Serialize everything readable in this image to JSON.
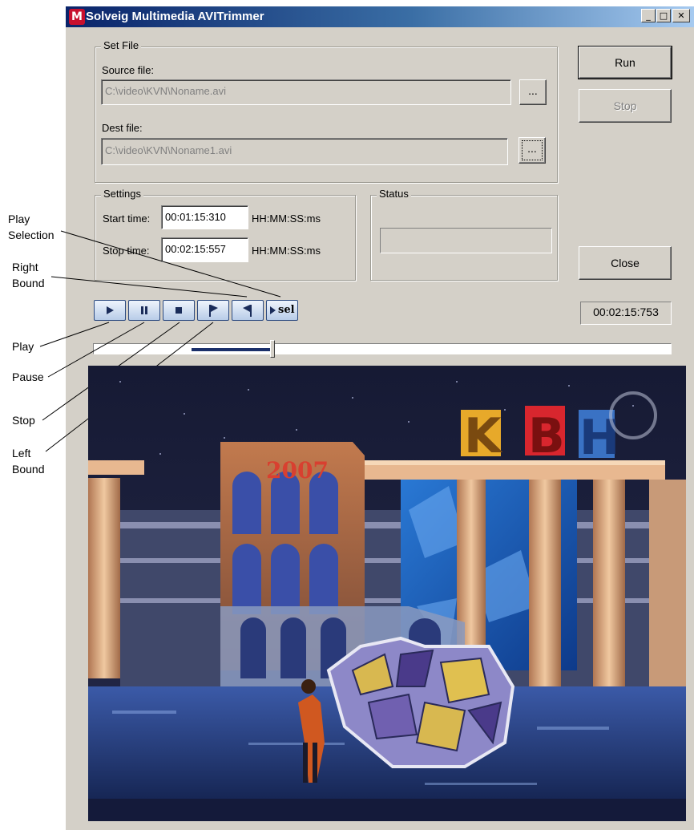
{
  "window": {
    "title": "Solveig Multimedia AVITrimmer",
    "icon_name": "app-logo-icon",
    "icon_letter": "M",
    "controls": [
      "minimize",
      "maximize",
      "close"
    ],
    "minimize_glyph": "_",
    "maximize_glyph": "□",
    "close_glyph": "✕"
  },
  "set_file": {
    "group_label": "Set File",
    "source_label": "Source file:",
    "source_value": "C:\\video\\KVN\\Noname.avi",
    "dest_label": "Dest file:",
    "dest_value": "C:\\video\\KVN\\Noname1.avi",
    "browse_label": "..."
  },
  "actions": {
    "run_label": "Run",
    "stop_label": "Stop",
    "close_label": "Close"
  },
  "settings": {
    "group_label": "Settings",
    "start_label": "Start time:",
    "start_value": "00:01:15:310",
    "stop_label": "Stop time:",
    "stop_value": "00:02:15:557",
    "format_hint": "HH:MM:SS:ms"
  },
  "status": {
    "group_label": "Status",
    "value": ""
  },
  "playback": {
    "buttons": [
      "play",
      "pause",
      "stop",
      "left-bound",
      "right-bound",
      "play-selection"
    ],
    "sel_text": "sel",
    "current_time": "00:02:15:753",
    "position_fraction": 0.31,
    "selection_start_fraction": 0.17,
    "selection_end_fraction": 0.31
  },
  "callouts": {
    "play_selection": [
      "Play",
      "Selection"
    ],
    "right_bound": [
      "Right",
      "Bound"
    ],
    "play": "Play",
    "pause": "Pause",
    "stop": "Stop",
    "left_bound": [
      "Left",
      "Bound"
    ]
  },
  "video": {
    "sign_letters": [
      "K",
      "B",
      "H"
    ],
    "tower_text": "2007",
    "accent_colors": {
      "k": "#e7a92a",
      "b": "#d8262e",
      "h": "#3a72c4"
    }
  }
}
